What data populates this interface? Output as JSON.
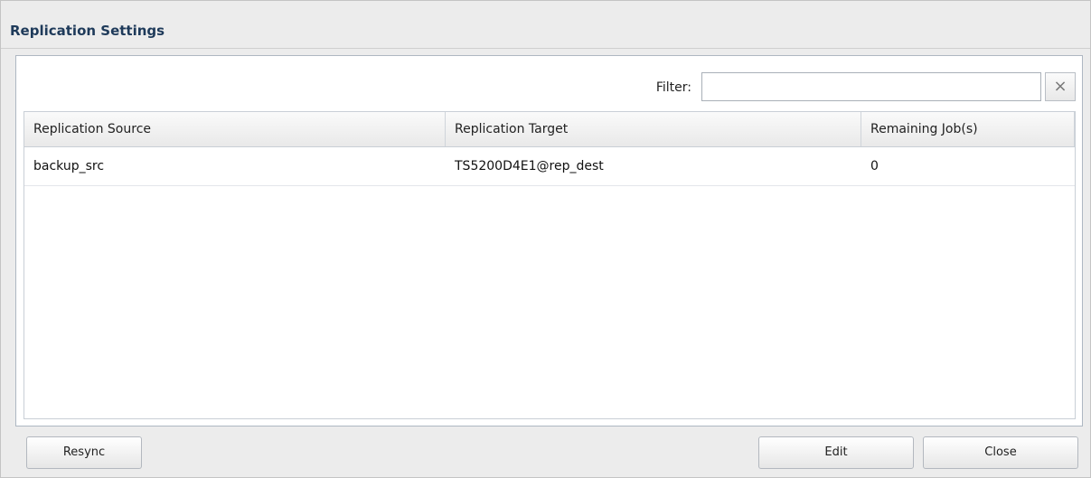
{
  "dialog": {
    "title": "Replication Settings"
  },
  "filter": {
    "label": "Filter:",
    "value": "",
    "clear_glyph": "×"
  },
  "table": {
    "columns": [
      "Replication Source",
      "Replication Target",
      "Remaining Job(s)"
    ],
    "rows": [
      [
        "backup_src",
        "TS5200D4E1@rep_dest",
        "0"
      ]
    ]
  },
  "buttons": {
    "resync": "Resync",
    "edit": "Edit",
    "close": "Close"
  },
  "icons": {
    "filter_clear": "close-icon"
  }
}
